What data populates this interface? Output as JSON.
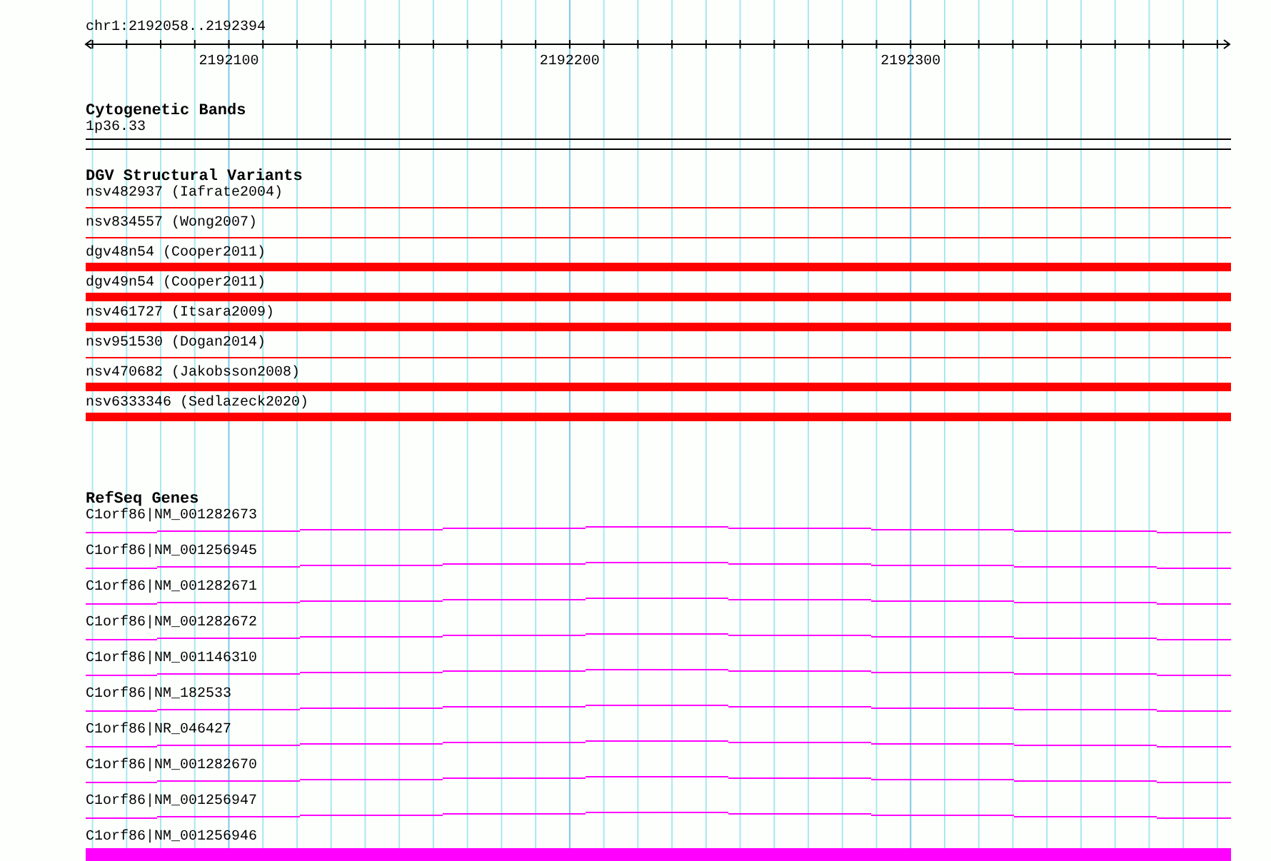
{
  "ruler": {
    "position": "chr1:2192058..2192394",
    "tick_labels": [
      "2192100",
      "2192200",
      "2192300"
    ]
  },
  "tracks": [
    {
      "title": "Cytogenetic Bands",
      "features": [
        {
          "label": "1p36.33",
          "kind": "band"
        }
      ]
    },
    {
      "title": "DGV Structural Variants",
      "features": [
        {
          "label": "nsv482937 (Iafrate2004)",
          "kind": "thin"
        },
        {
          "label": "nsv834557 (Wong2007)",
          "kind": "thin"
        },
        {
          "label": "dgv48n54 (Cooper2011)",
          "kind": "thick"
        },
        {
          "label": "dgv49n54 (Cooper2011)",
          "kind": "thick"
        },
        {
          "label": "nsv461727 (Itsara2009)",
          "kind": "thick"
        },
        {
          "label": "nsv951530 (Dogan2014)",
          "kind": "thin"
        },
        {
          "label": "nsv470682 (Jakobsson2008)",
          "kind": "thick"
        },
        {
          "label": "nsv6333346 (Sedlazeck2020)",
          "kind": "thick"
        }
      ]
    },
    {
      "title": "RefSeq Genes",
      "features": [
        {
          "label": "C1orf86|NM_001282673",
          "kind": "transcript"
        },
        {
          "label": "C1orf86|NM_001256945",
          "kind": "transcript"
        },
        {
          "label": "C1orf86|NM_001282671",
          "kind": "transcript"
        },
        {
          "label": "C1orf86|NM_001282672",
          "kind": "transcript"
        },
        {
          "label": "C1orf86|NM_001146310",
          "kind": "transcript"
        },
        {
          "label": "C1orf86|NM_182533",
          "kind": "transcript"
        },
        {
          "label": "C1orf86|NR_046427",
          "kind": "transcript"
        },
        {
          "label": "C1orf86|NM_001282670",
          "kind": "transcript"
        },
        {
          "label": "C1orf86|NM_001256947",
          "kind": "transcript"
        },
        {
          "label": "C1orf86|NM_001256946",
          "kind": "block"
        }
      ]
    }
  ]
}
